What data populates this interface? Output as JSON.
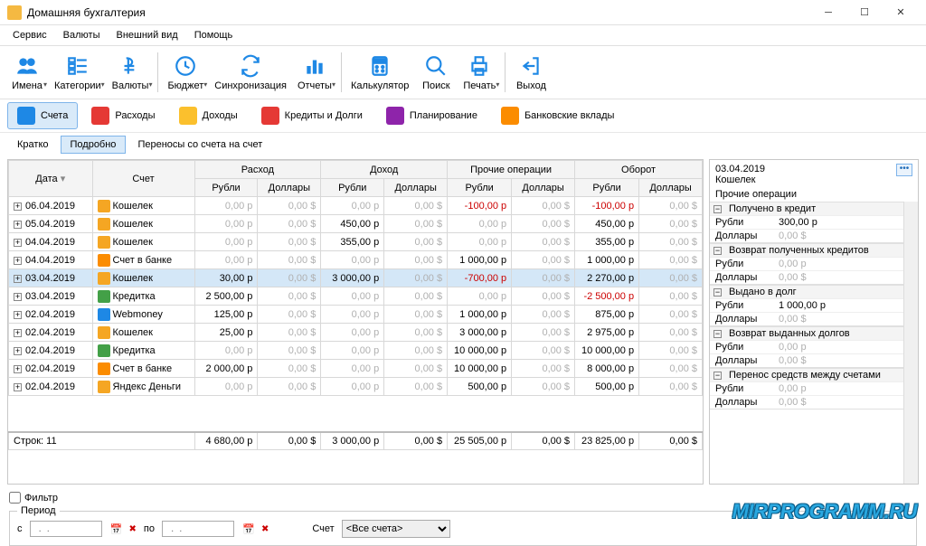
{
  "window": {
    "title": "Домашняя бухгалтерия"
  },
  "menu": [
    "Сервис",
    "Валюты",
    "Внешний вид",
    "Помощь"
  ],
  "toolbar": [
    {
      "label": "Имена",
      "drop": true
    },
    {
      "label": "Категории",
      "drop": true
    },
    {
      "label": "Валюты",
      "drop": true
    },
    {
      "sep": true
    },
    {
      "label": "Бюджет",
      "drop": true
    },
    {
      "label": "Синхронизация"
    },
    {
      "label": "Отчеты",
      "drop": true
    },
    {
      "sep": true
    },
    {
      "label": "Калькулятор"
    },
    {
      "label": "Поиск"
    },
    {
      "label": "Печать",
      "drop": true
    },
    {
      "sep": true
    },
    {
      "label": "Выход"
    }
  ],
  "navtabs": [
    {
      "label": "Счета",
      "active": true,
      "color": "#1e88e5"
    },
    {
      "label": "Расходы",
      "color": "#e53935"
    },
    {
      "label": "Доходы",
      "color": "#fbc02d"
    },
    {
      "label": "Кредиты и Долги",
      "color": "#e53935"
    },
    {
      "label": "Планирование",
      "color": "#8e24aa"
    },
    {
      "label": "Банковские вклады",
      "color": "#fb8c00"
    }
  ],
  "subtabs": [
    "Кратко",
    "Подробно",
    "Переносы со счета на счет"
  ],
  "subtab_active": 1,
  "grid": {
    "group_headers": [
      "Дата",
      "Счет",
      "Расход",
      "Доход",
      "Прочие операции",
      "Оборот"
    ],
    "sub_headers": [
      "Рубли",
      "Доллары",
      "Рубли",
      "Доллары",
      "Рубли",
      "Доллары",
      "Рубли",
      "Доллары"
    ],
    "rows": [
      {
        "date": "06.04.2019",
        "acct": "Кошелек",
        "ic": "#f5a623",
        "cells": [
          "0,00 р",
          "0,00 $",
          "0,00 р",
          "0,00 $",
          "-100,00 р",
          "0,00 $",
          "-100,00 р",
          "0,00 $"
        ],
        "gray": [
          0,
          1,
          2,
          3,
          5,
          7
        ],
        "neg": [
          4,
          6
        ]
      },
      {
        "date": "05.04.2019",
        "acct": "Кошелек",
        "ic": "#f5a623",
        "cells": [
          "0,00 р",
          "0,00 $",
          "450,00 р",
          "0,00 $",
          "0,00 р",
          "0,00 $",
          "450,00 р",
          "0,00 $"
        ],
        "gray": [
          0,
          1,
          3,
          4,
          5,
          7
        ]
      },
      {
        "date": "04.04.2019",
        "acct": "Кошелек",
        "ic": "#f5a623",
        "cells": [
          "0,00 р",
          "0,00 $",
          "355,00 р",
          "0,00 $",
          "0,00 р",
          "0,00 $",
          "355,00 р",
          "0,00 $"
        ],
        "gray": [
          0,
          1,
          3,
          4,
          5,
          7
        ]
      },
      {
        "date": "04.04.2019",
        "acct": "Счет в банке",
        "ic": "#fb8c00",
        "cells": [
          "0,00 р",
          "0,00 $",
          "0,00 р",
          "0,00 $",
          "1 000,00 р",
          "0,00 $",
          "1 000,00 р",
          "0,00 $"
        ],
        "gray": [
          0,
          1,
          2,
          3,
          5,
          7
        ]
      },
      {
        "date": "03.04.2019",
        "acct": "Кошелек",
        "ic": "#f5a623",
        "sel": true,
        "cells": [
          "30,00 р",
          "0,00 $",
          "3 000,00 р",
          "0,00 $",
          "-700,00 р",
          "0,00 $",
          "2 270,00 р",
          "0,00 $"
        ],
        "gray": [
          1,
          3,
          5,
          7
        ],
        "neg": [
          4
        ]
      },
      {
        "date": "03.04.2019",
        "acct": "Кредитка",
        "ic": "#43a047",
        "cells": [
          "2 500,00 р",
          "0,00 $",
          "0,00 р",
          "0,00 $",
          "0,00 р",
          "0,00 $",
          "-2 500,00 р",
          "0,00 $"
        ],
        "gray": [
          1,
          2,
          3,
          4,
          5,
          7
        ],
        "neg": [
          6
        ]
      },
      {
        "date": "02.04.2019",
        "acct": "Webmoney",
        "ic": "#1e88e5",
        "cells": [
          "125,00 р",
          "0,00 $",
          "0,00 р",
          "0,00 $",
          "1 000,00 р",
          "0,00 $",
          "875,00 р",
          "0,00 $"
        ],
        "gray": [
          1,
          2,
          3,
          5,
          7
        ]
      },
      {
        "date": "02.04.2019",
        "acct": "Кошелек",
        "ic": "#f5a623",
        "cells": [
          "25,00 р",
          "0,00 $",
          "0,00 р",
          "0,00 $",
          "3 000,00 р",
          "0,00 $",
          "2 975,00 р",
          "0,00 $"
        ],
        "gray": [
          1,
          2,
          3,
          5,
          7
        ]
      },
      {
        "date": "02.04.2019",
        "acct": "Кредитка",
        "ic": "#43a047",
        "cells": [
          "0,00 р",
          "0,00 $",
          "0,00 р",
          "0,00 $",
          "10 000,00 р",
          "0,00 $",
          "10 000,00 р",
          "0,00 $"
        ],
        "gray": [
          0,
          1,
          2,
          3,
          5,
          7
        ]
      },
      {
        "date": "02.04.2019",
        "acct": "Счет в банке",
        "ic": "#fb8c00",
        "cells": [
          "2 000,00 р",
          "0,00 $",
          "0,00 р",
          "0,00 $",
          "10 000,00 р",
          "0,00 $",
          "8 000,00 р",
          "0,00 $"
        ],
        "gray": [
          1,
          2,
          3,
          5,
          7
        ]
      },
      {
        "date": "02.04.2019",
        "acct": "Яндекс Деньги",
        "ic": "#f5a623",
        "cells": [
          "0,00 р",
          "0,00 $",
          "0,00 р",
          "0,00 $",
          "500,00 р",
          "0,00 $",
          "500,00 р",
          "0,00 $"
        ],
        "gray": [
          0,
          1,
          2,
          3,
          5,
          7
        ]
      }
    ],
    "totals": {
      "label": "Строк: 11",
      "cells": [
        "4 680,00 р",
        "0,00 $",
        "3 000,00 р",
        "0,00 $",
        "25 505,00 р",
        "0,00 $",
        "23 825,00 р",
        "0,00 $"
      ]
    }
  },
  "detail": {
    "date": "03.04.2019",
    "acct": "Кошелек",
    "heading": "Прочие операции",
    "sections": [
      {
        "title": "Получено в кредит",
        "rows": [
          [
            "Рубли",
            "300,00 р",
            false
          ],
          [
            "Доллары",
            "0,00 $",
            true
          ]
        ]
      },
      {
        "title": "Возврат полученных кредитов",
        "rows": [
          [
            "Рубли",
            "0,00 р",
            true
          ],
          [
            "Доллары",
            "0,00 $",
            true
          ]
        ]
      },
      {
        "title": "Выдано в долг",
        "rows": [
          [
            "Рубли",
            "1 000,00 р",
            false
          ],
          [
            "Доллары",
            "0,00 $",
            true
          ]
        ]
      },
      {
        "title": "Возврат выданных долгов",
        "rows": [
          [
            "Рубли",
            "0,00 р",
            true
          ],
          [
            "Доллары",
            "0,00 $",
            true
          ]
        ]
      },
      {
        "title": "Перенос средств между счетами",
        "rows": [
          [
            "Рубли",
            "0,00 р",
            true
          ],
          [
            "Доллары",
            "0,00 $",
            true
          ]
        ]
      }
    ]
  },
  "filter": {
    "checkbox": "Фильтр",
    "period": "Период",
    "from": "с",
    "to": "по",
    "date_ph": "  .  .",
    "acct_label": "Счет",
    "acct_value": "<Все счета>"
  },
  "watermark": "MIRPROGRAMM.RU"
}
